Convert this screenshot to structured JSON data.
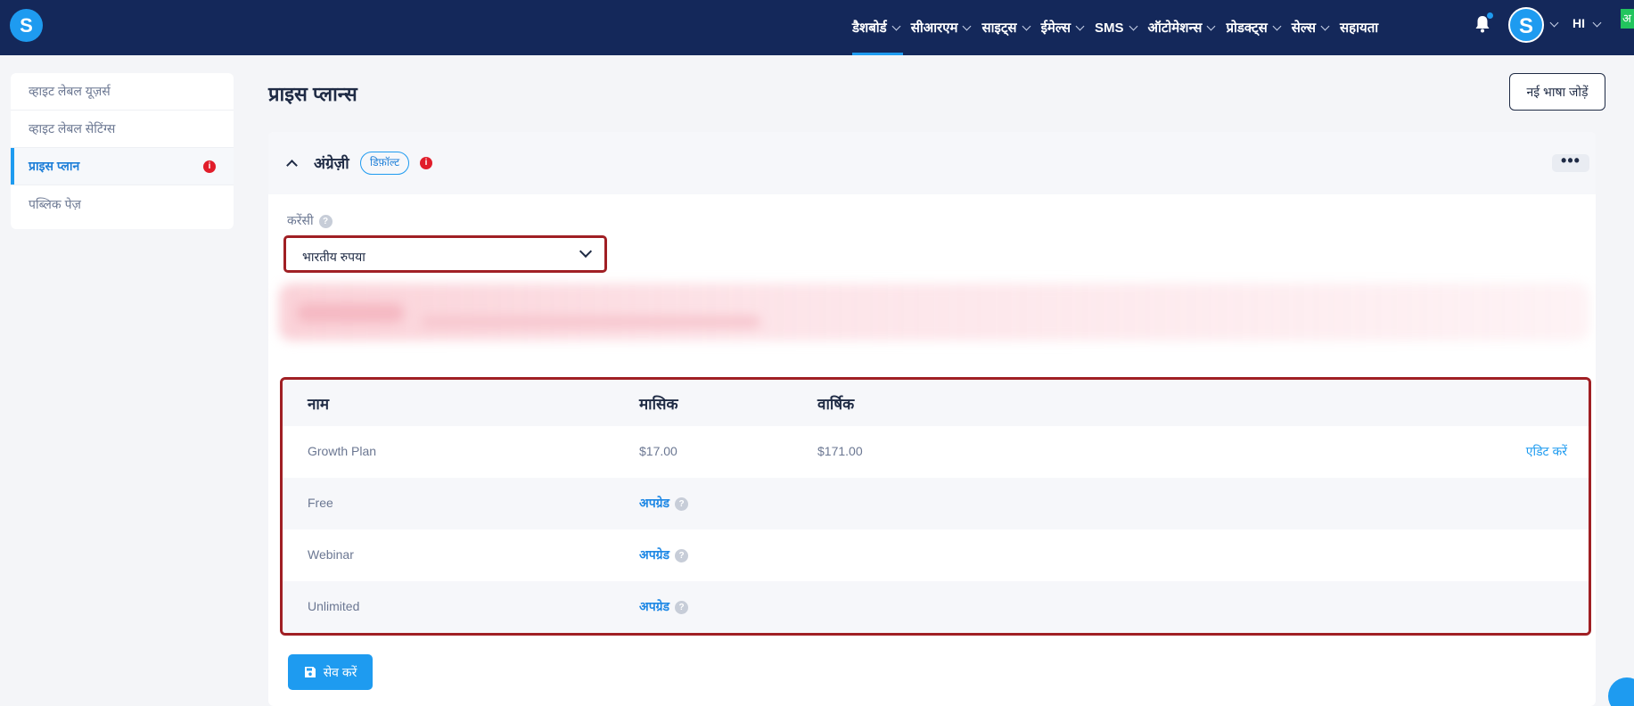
{
  "brand": {
    "logo_letter": "S"
  },
  "nav": {
    "items": [
      {
        "label": "डैशबोर्ड",
        "active": true
      },
      {
        "label": "सीआरएम"
      },
      {
        "label": "साइट्स"
      },
      {
        "label": "ईमेल्स"
      },
      {
        "label": "SMS"
      },
      {
        "label": "ऑटोमेशन्स"
      },
      {
        "label": "प्रोडक्ट्स"
      },
      {
        "label": "सेल्स"
      }
    ],
    "help_label": "सहायता",
    "avatar_letter": "S",
    "language": "HI",
    "corner_badge": "अ"
  },
  "sidebar": {
    "items": [
      {
        "label": "व्हाइट लेबल यूज़र्स"
      },
      {
        "label": "व्हाइट लेबल सेटिंग्स"
      },
      {
        "label": "प्राइस प्लान",
        "active": true,
        "alert": "i"
      },
      {
        "label": "पब्लिक पेज़"
      }
    ]
  },
  "header": {
    "title": "प्राइस प्लान्स",
    "add_language_button": "नई भाषा जोड़ें"
  },
  "language_card": {
    "language": "अंग्रेज़ी",
    "default_pill": "डिफ़ॉल्ट",
    "info_icon": "i",
    "more_label": "•••",
    "currency_label": "करेंसी",
    "currency_help": "?",
    "currency_value": "भारतीय रुपया"
  },
  "plans_table": {
    "columns": [
      "नाम",
      "मासिक",
      "वार्षिक"
    ],
    "rows": [
      {
        "name": "Growth Plan",
        "monthly": "$17.00",
        "yearly": "$171.00",
        "action": "एडिट करें"
      },
      {
        "name": "Free",
        "upgrade": "अपग्रेड"
      },
      {
        "name": "Webinar",
        "upgrade": "अपग्रेड"
      },
      {
        "name": "Unlimited",
        "upgrade": "अपग्रेड"
      }
    ],
    "help_glyph": "?"
  },
  "save_button": "सेव करें",
  "colors": {
    "topbar": "#14285a",
    "accent": "#1e9bf0",
    "highlight_border": "#a01f24",
    "alert": "#e11d2a"
  }
}
